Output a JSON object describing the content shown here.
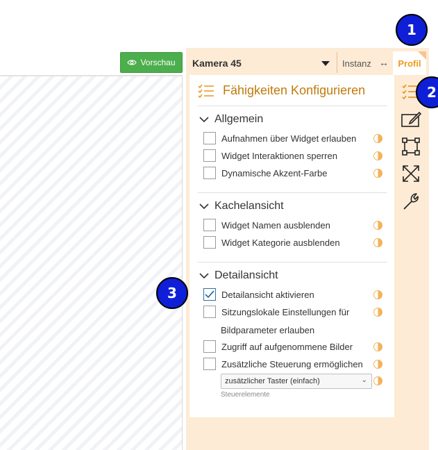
{
  "toolbar": {
    "preview_label": "Vorschau",
    "preview_icon": "eye-icon"
  },
  "panel": {
    "camera_name": "Kamera 45",
    "tab_instanz": "Instanz",
    "tab_arrow": "↔",
    "tab_profil": "Profil",
    "title": "Fähigkeiten Konfigurieren",
    "sections": [
      {
        "label": "Allgemein",
        "items": [
          {
            "label": "Aufnahmen über Widget erlauben",
            "checked": false
          },
          {
            "label": "Widget Interaktionen sperren",
            "checked": false
          },
          {
            "label": "Dynamische Akzent-Farbe",
            "checked": false
          }
        ]
      },
      {
        "label": "Kachelansicht",
        "items": [
          {
            "label": "Widget Namen ausblenden",
            "checked": false
          },
          {
            "label": "Widget Kategorie ausblenden",
            "checked": false
          }
        ]
      },
      {
        "label": "Detailansicht",
        "items": [
          {
            "label": "Detailansicht aktivieren",
            "checked": true
          },
          {
            "label": "Sitzungslokale Einstellungen für",
            "label2": "Bildparameter erlauben",
            "checked": false
          },
          {
            "label": "Zugriff auf aufgenommene Bilder",
            "checked": false
          },
          {
            "label": "Zusätzliche Steuerung ermöglichen",
            "checked": false
          }
        ]
      }
    ],
    "control_select": {
      "value": "zusätzlicher Taster (einfach)",
      "hint": "Steuerelemente"
    }
  },
  "rail": [
    "checklist-icon",
    "edit-card-icon",
    "crop-frame-icon",
    "expand-arrows-icon",
    "wrench-icon"
  ],
  "badges": [
    "1",
    "2",
    "3"
  ],
  "colors": {
    "accent": "#ef9b1c",
    "panel_bg": "#fdebd6",
    "preview_green": "#4cae4c",
    "badge_blue": "#0f1fd8",
    "check_blue": "#2a72a8"
  }
}
